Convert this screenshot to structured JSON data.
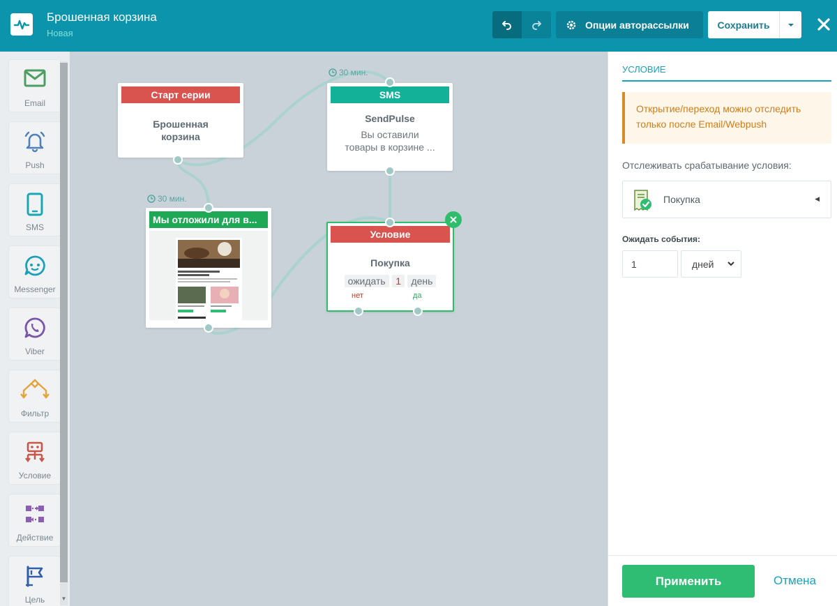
{
  "header": {
    "title": "Брошенная корзина",
    "subtitle": "Новая",
    "options_label": "Опции авторассылки",
    "save_label": "Сохранить"
  },
  "toolbar": {
    "items": [
      {
        "label": "Email",
        "icon": "envelope-icon"
      },
      {
        "label": "Push",
        "icon": "bell-icon"
      },
      {
        "label": "SMS",
        "icon": "phone-icon"
      },
      {
        "label": "Messenger",
        "icon": "chat-icon"
      },
      {
        "label": "Viber",
        "icon": "viber-icon"
      },
      {
        "label": "Фильтр",
        "icon": "filter-icon"
      },
      {
        "label": "Условие",
        "icon": "condition-icon"
      },
      {
        "label": "Действие",
        "icon": "action-icon"
      },
      {
        "label": "Цель",
        "icon": "flag-icon"
      }
    ]
  },
  "canvas": {
    "start_node": {
      "header": "Старт серии",
      "title_line1": "Брошенная",
      "title_line2": "корзина"
    },
    "sms_node": {
      "header": "SMS",
      "delay": "30 мин.",
      "title": "SendPulse",
      "text_line1": "Вы оставили",
      "text_line2": "товары в корзине ..."
    },
    "email_node": {
      "header": "Мы отложили для в...",
      "delay": "30 мин."
    },
    "condition_node": {
      "header": "Условие",
      "title": "Покупка",
      "wait_word": "ожидать",
      "wait_value": "1",
      "wait_unit": "день",
      "branch_no": "нет",
      "branch_yes": "да"
    }
  },
  "panel": {
    "title": "УСЛОВИЕ",
    "warning_line1": "Открытие/переход можно отследить",
    "warning_line2": "только после Email/Webpush",
    "track_label": "Отслеживать срабатывание условия:",
    "selected_condition": "Покупка",
    "wait_label": "Ожидать события:",
    "wait_value": "1",
    "wait_unit": "дней",
    "apply_label": "Применить",
    "cancel_label": "Отмена"
  },
  "colors": {
    "header_bg": "#0c94ad",
    "start_header": "#d9534f",
    "sms_header": "#13b197",
    "email_header": "#1fa855",
    "condition_header": "#d9534f",
    "accent": "#19a2bb",
    "apply_button": "#2ebd73"
  }
}
